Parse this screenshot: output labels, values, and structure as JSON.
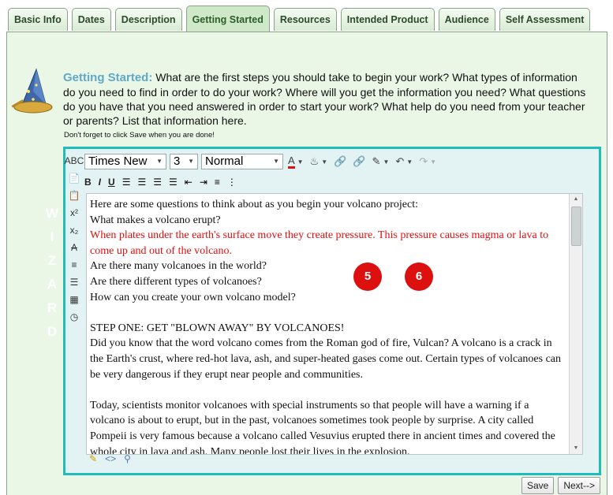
{
  "tabs": [
    "Basic Info",
    "Dates",
    "Description",
    "Getting Started",
    "Resources",
    "Intended Product",
    "Audience",
    "Self Assessment"
  ],
  "active_tab": "Getting Started",
  "wizard": {
    "letters": [
      "W",
      "I",
      "Z",
      "A",
      "R",
      "D"
    ]
  },
  "intro": {
    "heading": "Getting Started:",
    "text": " What are the first steps you should take to begin your work? What types of information do you need to find in order to do your work? Where will you get the information you need? What questions do you have that you need answered in order to start your work? What help do you need from your teacher or parents? List that information here.",
    "note": "Don't forget to click Save when you are done!"
  },
  "toolbar": {
    "font": "Times New",
    "size": "3",
    "format": "Normal",
    "row2": [
      "B",
      "I",
      "U"
    ]
  },
  "document": {
    "lines": [
      {
        "text": "Here are some questions to think about as you begin your volcano project:",
        "color": "black"
      },
      {
        "text": "What makes a volcano erupt?",
        "color": "black"
      },
      {
        "text": "When plates under the earth's surface move they create pressure.  This pressure causes magma or lava to come up and out of the volcano.",
        "color": "red"
      },
      {
        "text": "Are there many volcanoes in the world?",
        "color": "black"
      },
      {
        "text": "Are there different types of volcanoes?",
        "color": "black"
      },
      {
        "text": "How can you create your own volcano model?",
        "color": "black"
      },
      {
        "text": "",
        "color": "black"
      },
      {
        "text": "STEP ONE: GET \"BLOWN AWAY\" BY VOLCANOES!",
        "color": "black"
      },
      {
        "text": "Did you know that the word volcano comes from the Roman god of fire, Vulcan? A volcano is a crack in the Earth's crust, where red-hot lava, ash, and super-heated gases come out. Certain types of volcanoes can be very dangerous if they erupt near people and communities.",
        "color": "black"
      },
      {
        "text": "",
        "color": "black"
      },
      {
        "text": "Today, scientists monitor volcanoes with special instruments so that people will have a warning if a volcano is about to erupt, but in the past, volcanoes sometimes took people by surprise. A city called Pompeii is very famous because a volcano called Vesuvius erupted there in ancient times and covered the whole city in lava and ash. Many people lost their lives in the explosion.",
        "color": "black"
      }
    ]
  },
  "badges": [
    "5",
    "6"
  ],
  "buttons": {
    "save": "Save",
    "next": "Next-->"
  },
  "colors": {
    "accent": "#1fbcbc",
    "panel_bg": "#eaf7e6",
    "heading": "#5fa8c8",
    "badge": "#dd1010"
  }
}
